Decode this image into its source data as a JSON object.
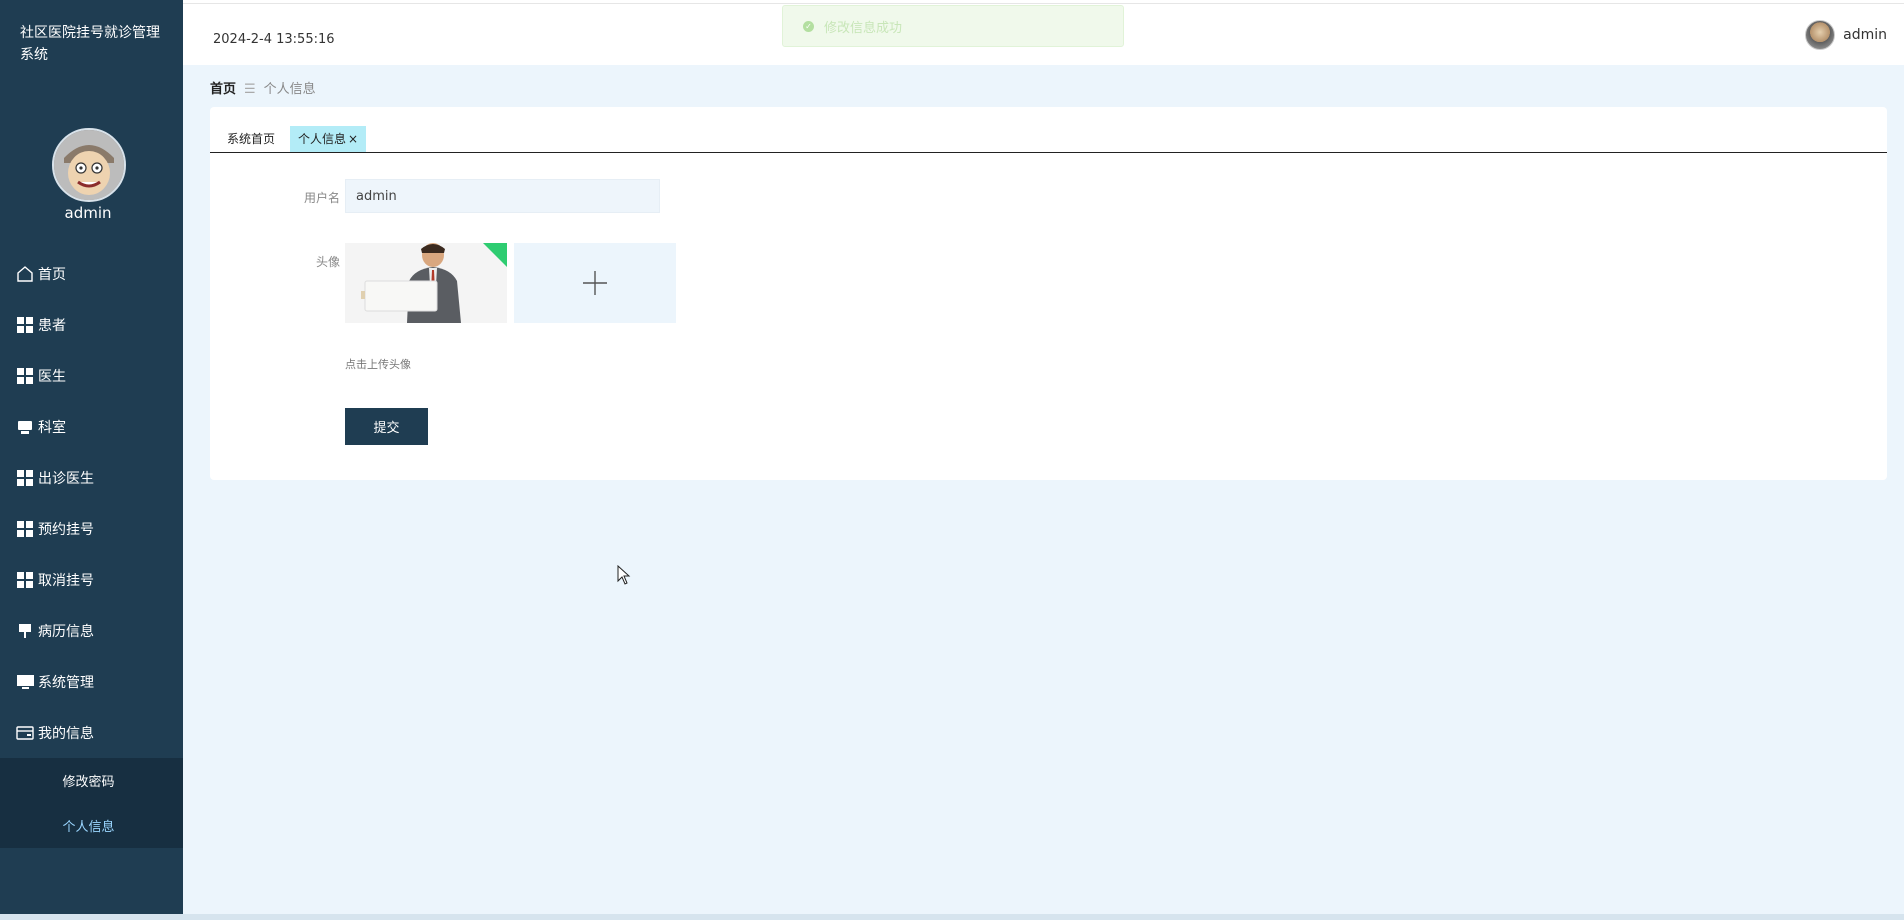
{
  "sidebar": {
    "system_title": "社区医院挂号就诊管理系统",
    "username": "admin",
    "items": [
      {
        "label": "首页",
        "icon": "home-icon"
      },
      {
        "label": "患者",
        "icon": "grid-icon"
      },
      {
        "label": "医生",
        "icon": "grid-icon"
      },
      {
        "label": "科室",
        "icon": "printer-icon"
      },
      {
        "label": "出诊医生",
        "icon": "grid-icon"
      },
      {
        "label": "预约挂号",
        "icon": "grid-icon"
      },
      {
        "label": "取消挂号",
        "icon": "grid-icon"
      },
      {
        "label": "病历信息",
        "icon": "pin-icon"
      },
      {
        "label": "系统管理",
        "icon": "monitor-icon"
      },
      {
        "label": "我的信息",
        "icon": "card-icon"
      }
    ],
    "submenu": [
      {
        "label": "修改密码"
      },
      {
        "label": "个人信息"
      }
    ]
  },
  "header": {
    "datetime": "2024-2-4 13:55:16",
    "username": "admin"
  },
  "toast": {
    "message": "修改信息成功",
    "color": "#f0f9eb"
  },
  "breadcrumb": {
    "home": "首页",
    "current": "个人信息"
  },
  "tabs": [
    {
      "label": "系统首页"
    },
    {
      "label": "个人信息"
    }
  ],
  "form": {
    "username_label": "用户名",
    "username_value": "admin",
    "avatar_label": "头像",
    "upload_hint": "点击上传头像",
    "submit_label": "提交"
  },
  "colors": {
    "sidebar": "#1f3d52",
    "background": "#ecf5fc",
    "active_tab": "#b3ecf7"
  }
}
